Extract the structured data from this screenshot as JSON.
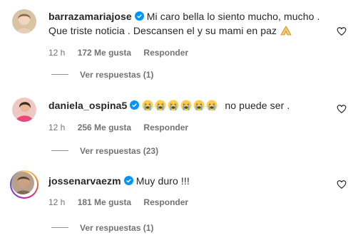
{
  "comments": [
    {
      "username": "barrazamariajose",
      "text_line1": "Mi caro bella lo siento mucho, mucho .",
      "text_line2": "Que triste noticia . Descansen el y su mami en paz",
      "time": "12 h",
      "likes": "172 Me gusta",
      "reply": "Responder",
      "view_replies": "Ver respuestas (1)"
    },
    {
      "username": "daniela_ospina5",
      "text_after_emojis": "no puede ser .",
      "time": "12 h",
      "likes": "256 Me gusta",
      "reply": "Responder",
      "view_replies": "Ver respuestas (23)"
    },
    {
      "username": "jossenarvaezm",
      "text": "Muy duro !!!",
      "time": "12 h",
      "likes": "181 Me gusta",
      "reply": "Responder",
      "view_replies": "Ver respuestas (1)"
    }
  ],
  "colors": {
    "verified": "#0095f6",
    "meta": "#737373",
    "text": "#262626"
  },
  "icons": [
    "verified-badge-icon",
    "heart-icon",
    "crying-emoji-icon",
    "folded-hands-emoji-icon"
  ]
}
